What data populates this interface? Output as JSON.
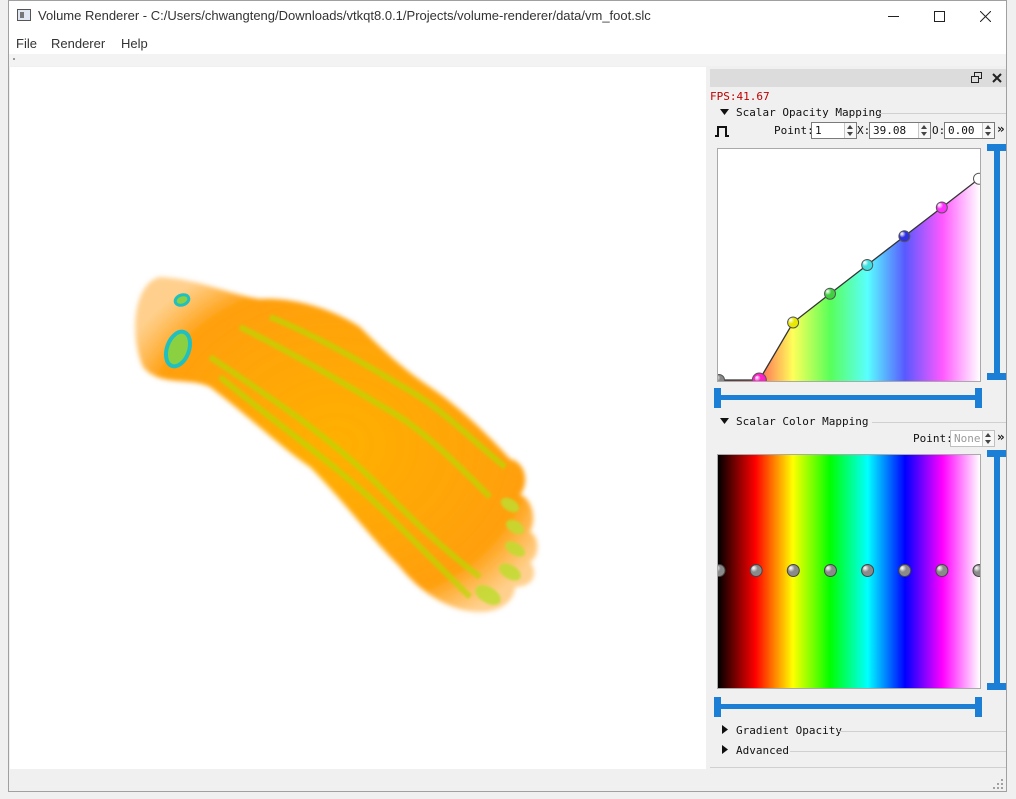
{
  "window": {
    "title": "Volume Renderer - C:/Users/chwangteng/Downloads/vtkqt8.0.1/Projects/volume-renderer/data/vm_foot.slc"
  },
  "menu": [
    {
      "label": "File"
    },
    {
      "label": "Renderer"
    },
    {
      "label": "Help"
    }
  ],
  "viewport": {
    "background": "#ffffff",
    "subject_icon": "volume-rendered-foot"
  },
  "dock": {
    "fps_text": "FPS:41.67",
    "opacity": {
      "title": "Scalar Opacity Mapping",
      "point_label": "Point:",
      "point_value": "1",
      "x_label": "X:",
      "x_value": "39.08",
      "o_label": "O:",
      "o_value": "0.00",
      "more_label": "»",
      "selected_point_index": 1,
      "points": [
        {
          "x": 0.0,
          "o": 0.0,
          "color": "#888888"
        },
        {
          "x": 0.155,
          "o": 0.0,
          "color": "#ff20c8"
        },
        {
          "x": 0.285,
          "o": 0.25,
          "color": "#e8e800"
        },
        {
          "x": 0.427,
          "o": 0.375,
          "color": "#40d040"
        },
        {
          "x": 0.57,
          "o": 0.5,
          "color": "#40e0e0"
        },
        {
          "x": 0.713,
          "o": 0.625,
          "color": "#3030e0"
        },
        {
          "x": 0.857,
          "o": 0.75,
          "color": "#ff30ff"
        },
        {
          "x": 1.0,
          "o": 0.875,
          "color": "#ffffff"
        }
      ]
    },
    "color": {
      "title": "Scalar Color Mapping",
      "point_label": "Point:",
      "point_value": "None",
      "more_label": "»",
      "gradient_stops": [
        "#000000",
        "#ff0000",
        "#ffff00",
        "#00ff00",
        "#00ffff",
        "#0000ff",
        "#ff00ff",
        "#ffffff"
      ],
      "point_count": 8
    },
    "gradient_opacity_label": "Gradient Opacity",
    "advanced_label": "Advanced"
  }
}
